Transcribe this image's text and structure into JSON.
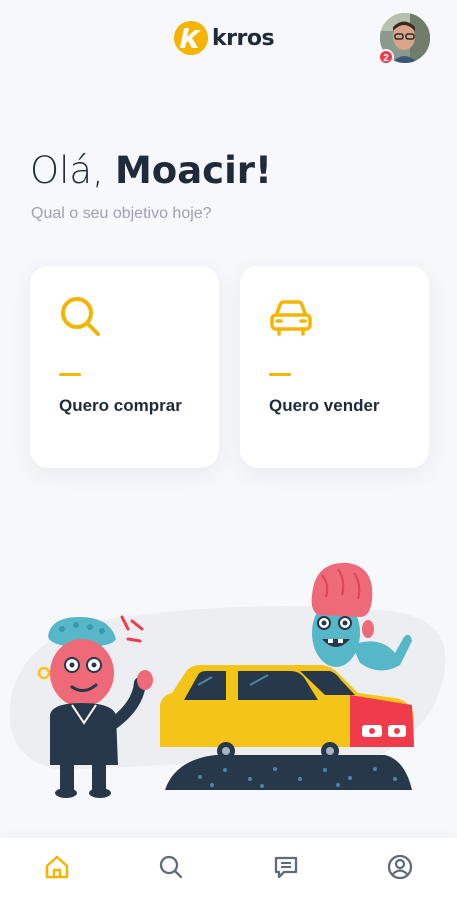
{
  "header": {
    "logo_text": "krros",
    "notification_count": "2"
  },
  "greeting": {
    "hello": "Olá,",
    "name": "Moacir!",
    "subtitle": "Qual o seu objetivo hoje?"
  },
  "options": [
    {
      "label": "Quero comprar",
      "icon": "search-icon"
    },
    {
      "label": "Quero vender",
      "icon": "car-icon"
    }
  ],
  "bottom_nav": [
    {
      "icon": "home-icon",
      "active": true
    },
    {
      "icon": "search-icon",
      "active": false
    },
    {
      "icon": "chat-icon",
      "active": false
    },
    {
      "icon": "profile-icon",
      "active": false
    }
  ],
  "colors": {
    "accent": "#f5b400",
    "text_dark": "#1f2a3a",
    "text_muted": "#9aa2b1",
    "background": "#f7f8fb",
    "badge": "#ef3b4a"
  }
}
